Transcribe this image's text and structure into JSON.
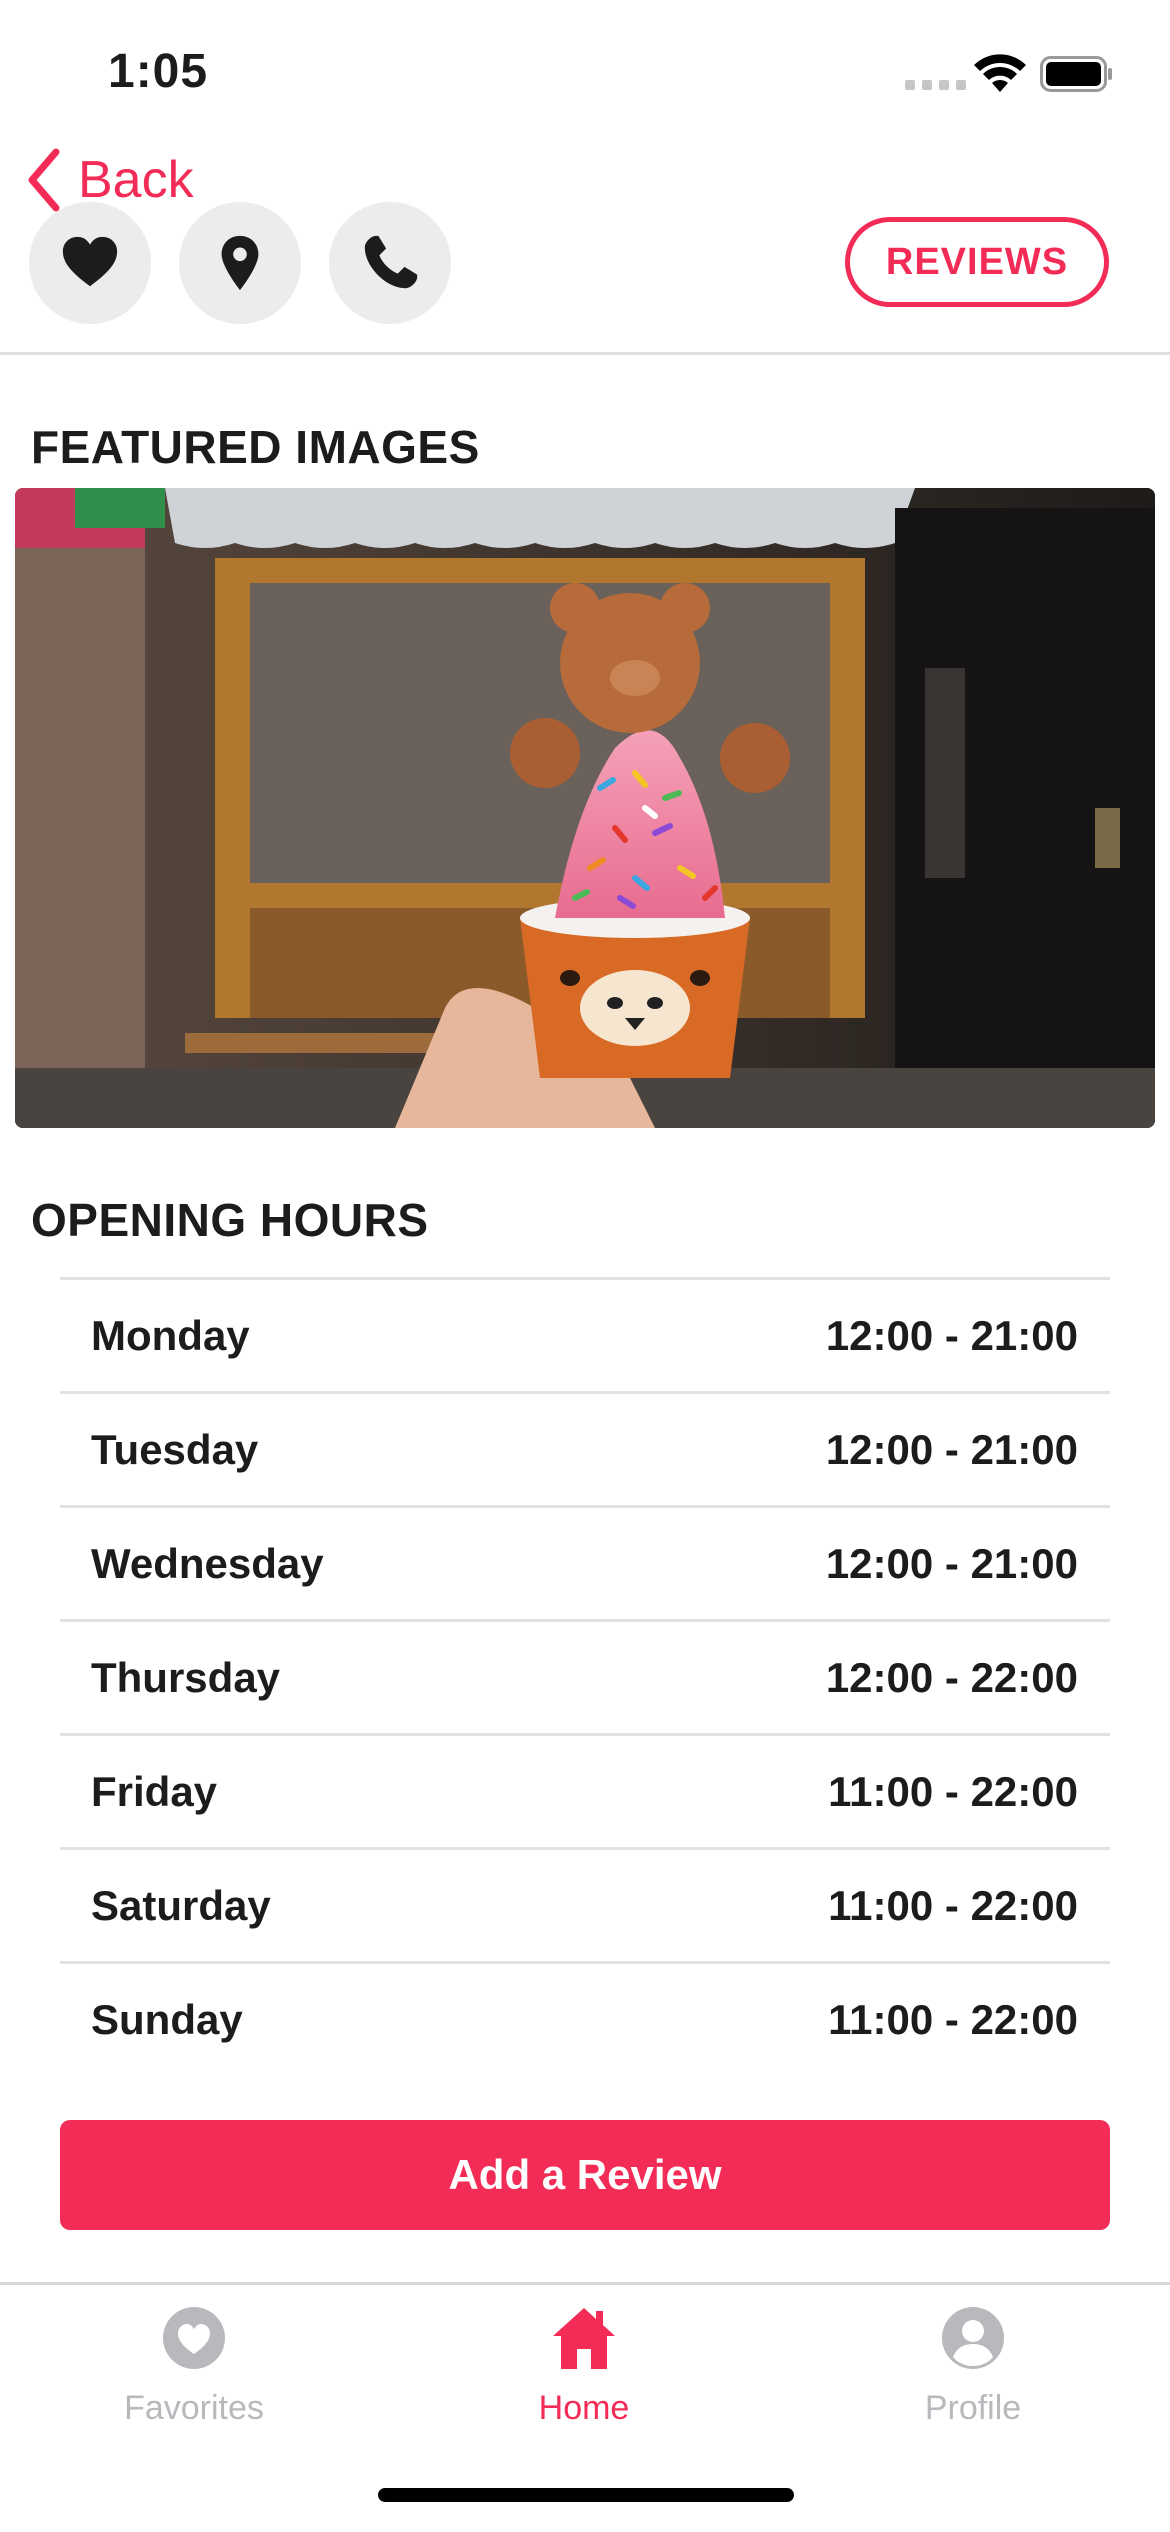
{
  "status_bar": {
    "time": "1:05",
    "icons": [
      "cellular-signal-icon",
      "wifi-icon",
      "battery-icon"
    ]
  },
  "nav": {
    "back_label": "Back",
    "actions": [
      {
        "name": "favorite",
        "icon": "heart-icon"
      },
      {
        "name": "location",
        "icon": "map-pin-icon"
      },
      {
        "name": "call",
        "icon": "phone-icon"
      }
    ],
    "reviews_label": "REVIEWS"
  },
  "featured": {
    "title": "FEATURED IMAGES"
  },
  "hours": {
    "title": "OPENING HOURS",
    "rows": [
      {
        "day": "Monday",
        "time": "12:00 - 21:00"
      },
      {
        "day": "Tuesday",
        "time": "12:00 - 21:00"
      },
      {
        "day": "Wednesday",
        "time": "12:00 - 21:00"
      },
      {
        "day": "Thursday",
        "time": "12:00 - 22:00"
      },
      {
        "day": "Friday",
        "time": "11:00 - 22:00"
      },
      {
        "day": "Saturday",
        "time": "11:00 - 22:00"
      },
      {
        "day": "Sunday",
        "time": "11:00 - 22:00"
      }
    ]
  },
  "add_review_label": "Add a Review",
  "tabs": [
    {
      "label": "Favorites",
      "icon": "heart-circle-icon",
      "active": false
    },
    {
      "label": "Home",
      "icon": "home-icon",
      "active": true
    },
    {
      "label": "Profile",
      "icon": "profile-icon",
      "active": false
    }
  ],
  "colors": {
    "accent": "#f32c57",
    "inactive_tab": "#b8b8bd",
    "circle_bg": "#ececec"
  }
}
